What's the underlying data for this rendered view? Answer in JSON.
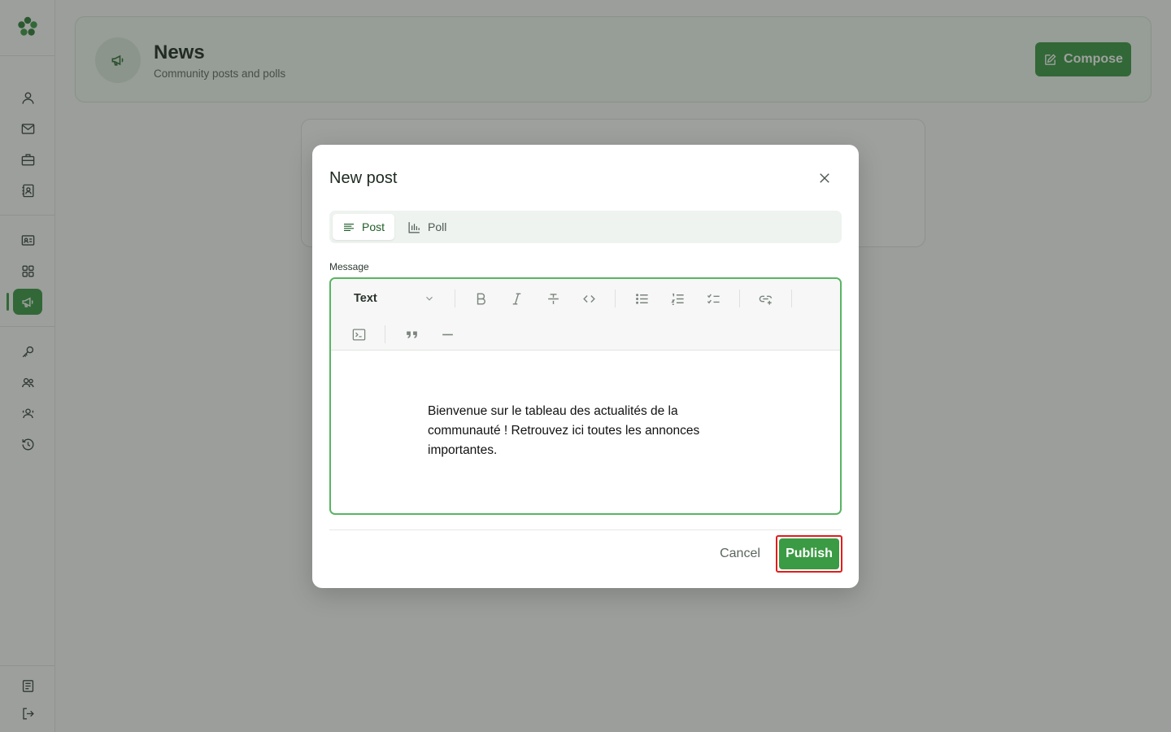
{
  "app": {
    "brand_color": "#3b9a44",
    "overlay_color": "rgba(40,44,40,0.45)"
  },
  "sidebar": {
    "top_items": [
      {
        "icon": "user-icon"
      },
      {
        "icon": "mail-icon"
      },
      {
        "icon": "briefcase-icon"
      },
      {
        "icon": "contact-book-icon"
      }
    ],
    "middle_items": [
      {
        "icon": "id-card-icon"
      },
      {
        "icon": "grid-icon"
      },
      {
        "icon": "megaphone-icon",
        "active": true
      }
    ],
    "lower_items": [
      {
        "icon": "key-icon"
      },
      {
        "icon": "users-icon"
      },
      {
        "icon": "users-group-icon"
      },
      {
        "icon": "history-icon"
      }
    ],
    "bottom_items": [
      {
        "icon": "document-icon"
      },
      {
        "icon": "logout-icon"
      }
    ]
  },
  "header": {
    "title": "News",
    "subtitle": "Community posts and polls",
    "compose_label": "Compose"
  },
  "modal": {
    "title": "New post",
    "tabs": [
      {
        "label": "Post",
        "icon": "text-lines-icon",
        "active": true
      },
      {
        "label": "Poll",
        "icon": "bar-chart-icon",
        "active": false
      }
    ],
    "message_label": "Message",
    "editor": {
      "block_type": "Text",
      "toolbar": [
        "bold-icon",
        "italic-icon",
        "strikethrough-icon",
        "code-icon",
        "bullet-list-icon",
        "numbered-list-icon",
        "checklist-icon",
        "link-add-icon",
        "code-block-icon",
        "quote-icon",
        "horizontal-rule-icon"
      ],
      "content": "Bienvenue sur le tableau des actualités de la communauté ! Retrouvez ici toutes les annonces importantes."
    },
    "cancel_label": "Cancel",
    "publish_label": "Publish"
  }
}
